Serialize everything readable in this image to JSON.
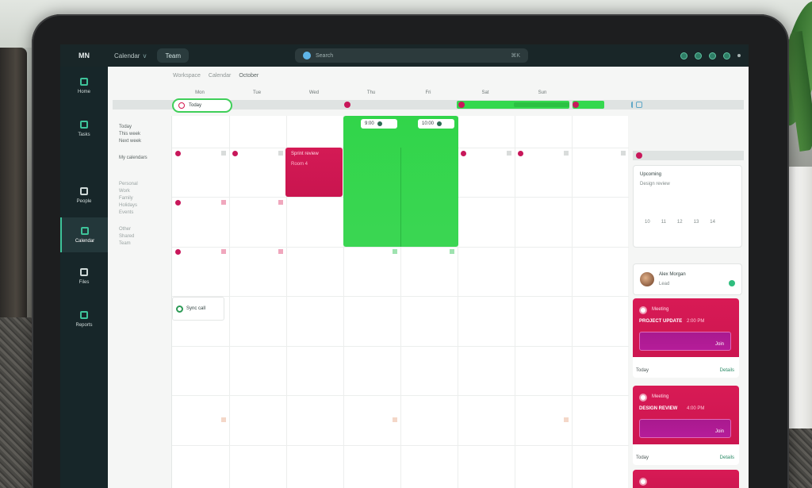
{
  "topbar": {
    "logo": "MN",
    "brand": "Calendar",
    "brand_caret": "v",
    "workspace_button": "Team",
    "search_placeholder": "Search",
    "search_shortcut": "⌘K"
  },
  "sidebar": {
    "items": [
      {
        "label": "Home"
      },
      {
        "label": "Tasks"
      },
      {
        "label": "People"
      },
      {
        "label": "Calendar"
      },
      {
        "label": "Files"
      },
      {
        "label": "Reports"
      }
    ]
  },
  "main": {
    "crumbs": [
      "Workspace",
      "Calendar",
      "October"
    ],
    "today_label": "Today"
  },
  "columns": [
    "Mon",
    "Tue",
    "Wed",
    "Thu",
    "Fri",
    "Sat",
    "Sun"
  ],
  "green_event": {
    "pill_a": "9:00",
    "pill_b": "10:00"
  },
  "red_event": {
    "title": "Sprint review",
    "subtitle": "Room 4"
  },
  "chip_event": {
    "label": "Sync call"
  },
  "right_panel": {
    "card1_title": "Upcoming",
    "card1_sub": "Design review",
    "card1_meta": [
      "10",
      "11",
      "12",
      "13",
      "14"
    ],
    "card2_name": "Alex Morgan",
    "card2_role": "Lead",
    "big_cards": [
      {
        "title": "Meeting",
        "label": "PROJECT UPDATE",
        "time": "2:00 PM",
        "bar": "Join",
        "foot": "Today",
        "foot2": "Details"
      },
      {
        "title": "Meeting",
        "label": "DESIGN REVIEW",
        "time": "4:00 PM",
        "bar": "Join",
        "foot": "Today",
        "foot2": "Details"
      }
    ]
  },
  "side_list": {
    "group_a": [
      "Today",
      "This week",
      "Next week"
    ],
    "group_b": [
      "My calendars"
    ],
    "group_c": [
      "Personal",
      "Work",
      "Family",
      "Holidays",
      "Events"
    ],
    "group_d": [
      "Other",
      "Shared",
      "Team"
    ]
  },
  "colors": {
    "accent_green": "#34d84e",
    "accent_red": "#d41a55",
    "accent_purple": "#b51c99",
    "sidebar_bg": "#172629"
  }
}
